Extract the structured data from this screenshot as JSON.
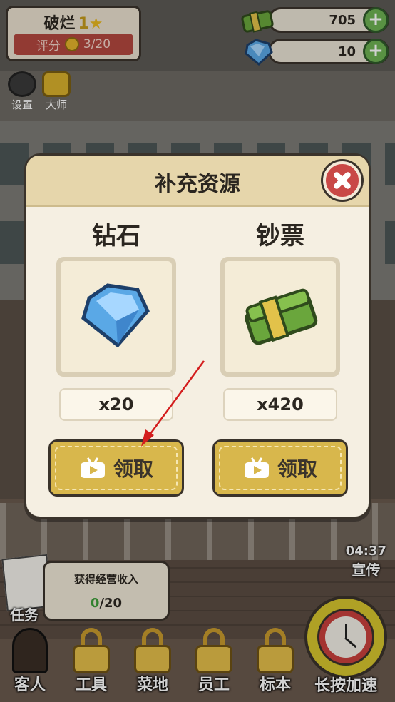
{
  "hud": {
    "rank_label": "破烂",
    "rank_level": "1",
    "score_label": "评分",
    "score_value": "3/20",
    "cash": "705",
    "diamonds": "10",
    "settings_label": "设置",
    "master_label": "大师"
  },
  "modal": {
    "title": "补充资源",
    "items": [
      {
        "name": "钻石",
        "icon": "diamond-icon",
        "quantity": "x20",
        "button": "领取"
      },
      {
        "name": "钞票",
        "icon": "cash-icon",
        "quantity": "x420",
        "button": "领取"
      }
    ]
  },
  "task": {
    "description": "获得经营收入",
    "progress_current": "0",
    "progress_total": "/20",
    "label": "任务"
  },
  "promo": {
    "timer": "04:37",
    "label": "宣传"
  },
  "bottom_bar": {
    "items": [
      {
        "label": "客人"
      },
      {
        "label": "工具"
      },
      {
        "label": "菜地"
      },
      {
        "label": "员工"
      },
      {
        "label": "标本"
      }
    ],
    "speed_label": "长按加速"
  },
  "colors": {
    "accent_gold": "#d8b74c",
    "close_red": "#c94846",
    "plus_green": "#6db152",
    "score_bar_red": "#b2473f"
  }
}
